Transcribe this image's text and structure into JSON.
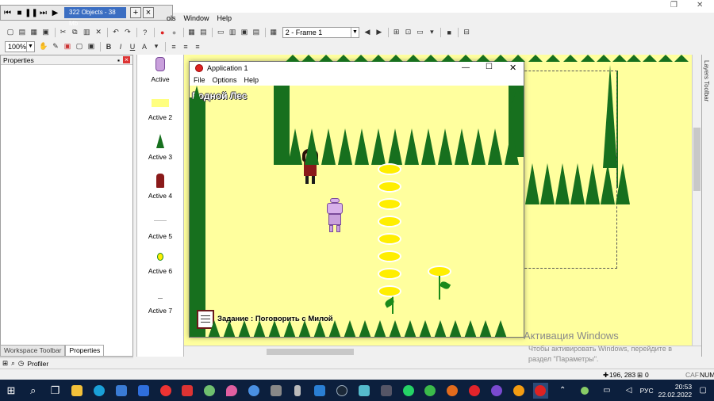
{
  "playbar": {
    "info": "322 Objects - 38 Mb",
    "plus": "+",
    "close": "×"
  },
  "menu": {
    "partial": "ols",
    "window": "Window",
    "help": "Help"
  },
  "toolbar": {
    "frame_select": "2 - Frame 1",
    "zoom_select": "100%",
    "bold": "B",
    "italic": "I",
    "underline": "U"
  },
  "left_panel": {
    "title": "Properties",
    "pin": "▪",
    "close": "×",
    "tab_workspace": "Workspace Toolbar",
    "tab_properties": "Properties",
    "profiler": "Profiler"
  },
  "objects": [
    "Active",
    "Active 2",
    "Active 3",
    "Active 4",
    "Active 5",
    "Active 6",
    "Active 7"
  ],
  "app_window": {
    "title": "Application 1",
    "menu": [
      "File",
      "Options",
      "Help"
    ],
    "level_title": "Родной Лес",
    "task": "Задание : Поговорить с Милой"
  },
  "layers_toolbar": "Layers Toolbar",
  "status": {
    "coords": "196, 283",
    "count": "0",
    "caps": "CAF",
    "num": "NUM"
  },
  "watermark": {
    "title": "Активация Windows",
    "line1": "Чтобы активировать Windows, перейдите в",
    "line2": "раздел \"Параметры\"."
  },
  "taskbar": {
    "lang": "РУС",
    "time": "20:53",
    "date": "22.02.2022"
  },
  "colors": {
    "scene_bg": "#ffff9e",
    "tree": "#17701e",
    "taskbar": "#0c1f3d"
  }
}
